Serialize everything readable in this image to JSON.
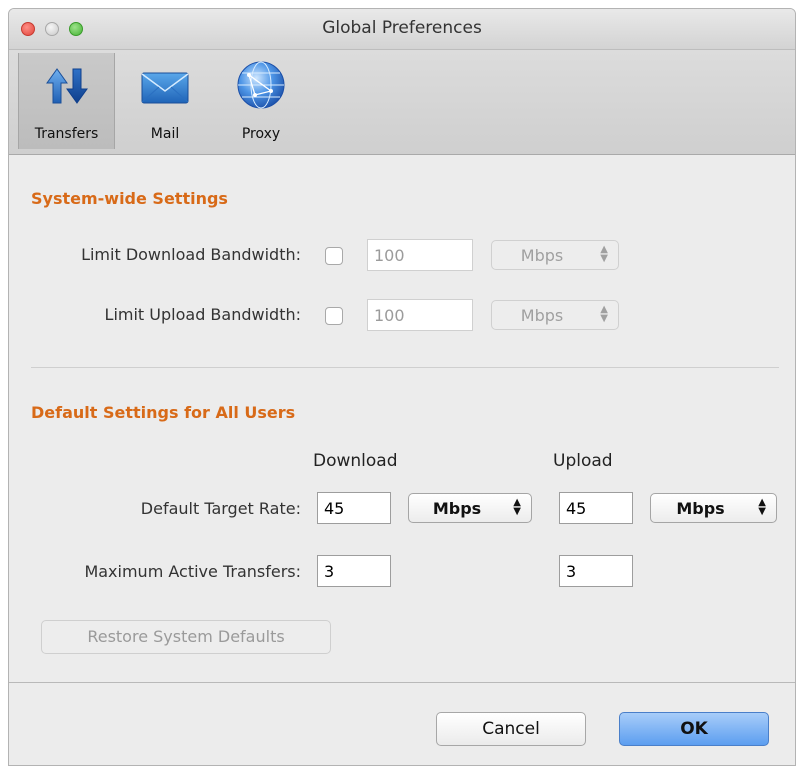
{
  "window": {
    "title": "Global Preferences"
  },
  "toolbar": {
    "items": [
      {
        "label": "Transfers",
        "icon": "transfers-arrows-icon",
        "selected": true
      },
      {
        "label": "Mail",
        "icon": "envelope-icon",
        "selected": false
      },
      {
        "label": "Proxy",
        "icon": "globe-network-icon",
        "selected": false
      }
    ]
  },
  "system": {
    "title": "System-wide Settings",
    "download": {
      "label": "Limit Download Bandwidth:",
      "checked": false,
      "value": "100",
      "unit": "Mbps"
    },
    "upload": {
      "label": "Limit Upload Bandwidth:",
      "checked": false,
      "value": "100",
      "unit": "Mbps"
    }
  },
  "defaults": {
    "title": "Default Settings for All Users",
    "col_download": "Download",
    "col_upload": "Upload",
    "target_rate": {
      "label": "Default Target Rate:",
      "download_value": "45",
      "download_unit": "Mbps",
      "upload_value": "45",
      "upload_unit": "Mbps"
    },
    "max_active": {
      "label": "Maximum Active Transfers:",
      "download_value": "3",
      "upload_value": "3"
    },
    "restore_label": "Restore System Defaults"
  },
  "buttons": {
    "cancel": "Cancel",
    "ok": "OK"
  },
  "colors": {
    "section_title": "#d86a18",
    "ok_button": "#5c9ef0"
  }
}
